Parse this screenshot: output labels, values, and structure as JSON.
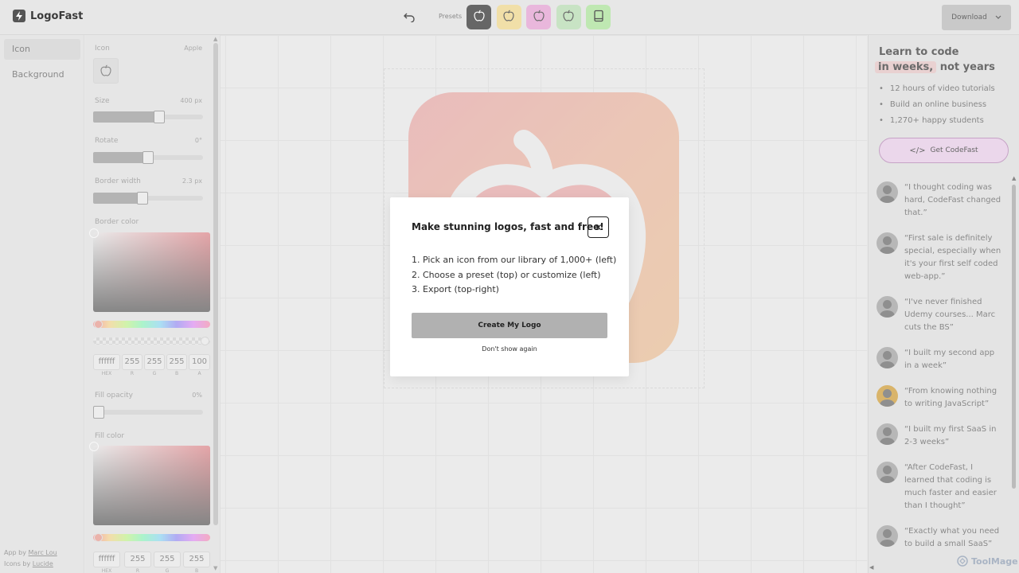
{
  "app": {
    "name": "LogoFast"
  },
  "header": {
    "presets_label": "Presets",
    "download_label": "Download"
  },
  "presets": [
    {
      "name": "dark",
      "bg": "#666666",
      "fg": "#ffffff"
    },
    {
      "name": "yellow",
      "bg": "#f1dfa8",
      "fg": "#6b6b6b"
    },
    {
      "name": "pink",
      "bg": "#e9b7dc",
      "fg": "#6b6b6b"
    },
    {
      "name": "green",
      "bg": "#c8e3c4",
      "fg": "#6b6b6b"
    },
    {
      "name": "green-book",
      "bg": "#bfe8b2",
      "fg": "#555555"
    }
  ],
  "nav": {
    "items": [
      "Icon",
      "Background"
    ]
  },
  "credits": {
    "app_prefix": "App by ",
    "app_author": "Marc Lou",
    "icons_prefix": "Icons by ",
    "icons_author": "Lucide"
  },
  "panel": {
    "icon_label": "Icon",
    "icon_value": "Apple",
    "size_label": "Size",
    "size_value": "400 px",
    "rotate_label": "Rotate",
    "rotate_value": "0°",
    "border_width_label": "Border width",
    "border_width_value": "2.3 px",
    "border_color_label": "Border color",
    "fill_opacity_label": "Fill opacity",
    "fill_opacity_value": "0%",
    "fill_color_label": "Fill color",
    "slider_levels": {
      "size": 0.6,
      "rotate": 0.5,
      "border_width": 0.45,
      "fill_opacity": 0.0
    },
    "border_color_fields": {
      "hex": "ffffff",
      "r": "255",
      "g": "255",
      "b": "255",
      "a": "100"
    },
    "fill_color_fields": {
      "hex": "ffffff",
      "r": "255",
      "g": "255",
      "b": "255"
    },
    "field_labels": {
      "hex": "HEX",
      "r": "R",
      "g": "G",
      "b": "B",
      "a": "A"
    }
  },
  "modal": {
    "title": "Make stunning logos, fast and free!",
    "steps": [
      "1. Pick an icon from our library of 1,000+ (left)",
      "2. Choose a preset (top) or customize (left)",
      "3. Export (top-right)"
    ],
    "cta": "Create My Logo",
    "dismiss": "Don't show again"
  },
  "promo": {
    "headline_1": "Learn to code",
    "headline_highlight": "in weeks,",
    "headline_2": "not years",
    "bullets": [
      "12 hours of video tutorials",
      "Build an online business",
      "1,270+ happy students"
    ],
    "button": "Get CodeFast",
    "testimonials": [
      "“I thought coding was hard, CodeFast changed that.”",
      "“First sale is definitely special, especially when it's your first self coded web-app.”",
      "“I've never finished Udemy courses... Marc cuts the BS”",
      "“I built my second app in a week”",
      "“From knowing nothing to writing JavaScript”",
      "“I built my first SaaS in 2-3 weeks”",
      "“After CodeFast, I learned that coding is much faster and easier than I thought”",
      "“Exactly what you need to build a small SaaS”"
    ]
  },
  "watermark": "ToolMage",
  "colors": {
    "accent_gradient_start": "#e9a3a3",
    "accent_gradient_end": "#ecbd90",
    "cta_bg": "#b1b1b1"
  }
}
